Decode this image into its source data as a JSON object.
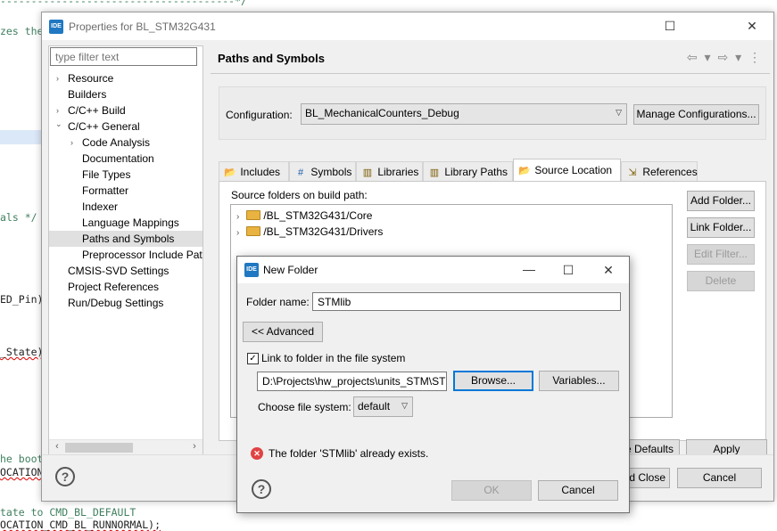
{
  "editor": {
    "lines": [
      "--------------------------------------*/",
      "zes the",
      "als */",
      "ED_Pin)",
      "_State)",
      "he boot",
      "OCATION",
      "tate to CMD_BL_DEFAULT",
      "OCATION_CMD_BL_RUNNORMAL);"
    ]
  },
  "window": {
    "badge": "IDE",
    "title": "Properties for BL_STM32G431",
    "minimize": "—",
    "maximize": "☐",
    "close": "✕"
  },
  "filter": {
    "placeholder": "type filter text"
  },
  "tree": [
    {
      "label": "Resource",
      "twisty": "›"
    },
    {
      "label": "Builders",
      "twisty": ""
    },
    {
      "label": "C/C++ Build",
      "twisty": "›"
    },
    {
      "label": "C/C++ General",
      "twisty": "⌄"
    },
    {
      "label": "Code Analysis",
      "twisty": "›"
    },
    {
      "label": "Documentation",
      "twisty": ""
    },
    {
      "label": "File Types",
      "twisty": ""
    },
    {
      "label": "Formatter",
      "twisty": ""
    },
    {
      "label": "Indexer",
      "twisty": ""
    },
    {
      "label": "Language Mappings",
      "twisty": ""
    },
    {
      "label": "Paths and Symbols",
      "twisty": ""
    },
    {
      "label": "Preprocessor Include Pat",
      "twisty": ""
    },
    {
      "label": "CMSIS-SVD Settings",
      "twisty": ""
    },
    {
      "label": "Project References",
      "twisty": ""
    },
    {
      "label": "Run/Debug Settings",
      "twisty": ""
    }
  ],
  "page": {
    "title": "Paths and Symbols",
    "nav": "⇦ ▾ ⇨ ▾ ⋮"
  },
  "config": {
    "label": "Configuration:",
    "value": "BL_MechanicalCounters_Debug",
    "manage": "Manage Configurations..."
  },
  "tabs": [
    {
      "label": "Includes",
      "icon": "includes-icon",
      "glyph": "📂"
    },
    {
      "label": "Symbols",
      "icon": "symbols-icon",
      "glyph": "#"
    },
    {
      "label": "Libraries",
      "icon": "libraries-icon",
      "glyph": "▥"
    },
    {
      "label": "Library Paths",
      "icon": "library-paths-icon",
      "glyph": "▥"
    },
    {
      "label": "Source Location",
      "icon": "source-location-icon",
      "glyph": "📂"
    },
    {
      "label": "References",
      "icon": "references-icon",
      "glyph": "⇲"
    }
  ],
  "source": {
    "label": "Source folders on build path:",
    "folders": [
      {
        "path": "/BL_STM32G431/Core"
      },
      {
        "path": "/BL_STM32G431/Drivers"
      }
    ],
    "add_folder": "Add Folder...",
    "link_folder": "Link Folder...",
    "edit_filter": "Edit Filter...",
    "delete": "Delete"
  },
  "footer": {
    "restore_partial": "e Defaults",
    "apply": "Apply",
    "apply_close_partial": "d Close",
    "cancel": "Cancel",
    "help": "?"
  },
  "dialog": {
    "title": "New Folder",
    "folder_name_label": "Folder name:",
    "folder_name_value": "STMlib",
    "advanced": "<< Advanced",
    "link_label": "Link to folder in the file system",
    "link_checked": "✓",
    "path_value": "D:\\Projects\\hw_projects\\units_STM\\ST",
    "browse": "Browse...",
    "variables": "Variables...",
    "fs_label": "Choose file system:",
    "fs_value": "default",
    "error": "The folder 'STMlib' already exists.",
    "ok": "OK",
    "cancel": "Cancel"
  },
  "colors": {
    "accent": "#0078d7",
    "error": "#e04343",
    "folder": "#e8b341",
    "badge": "#1f78c1"
  }
}
